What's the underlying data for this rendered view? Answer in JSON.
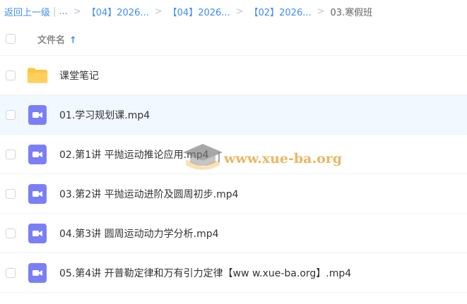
{
  "breadcrumb": {
    "back": "返回上一级",
    "pipe": "|",
    "ellipsis": "...",
    "sep": ">",
    "crumbs": [
      "【04】2026...",
      "【04】2026...",
      "【02】2026..."
    ],
    "current": "03.寒假班"
  },
  "header": {
    "column_title": "文件名",
    "sort_arrow": "↑"
  },
  "files": [
    {
      "name": "课堂笔记",
      "type": "folder"
    },
    {
      "name": "01.学习规划课.mp4",
      "type": "video"
    },
    {
      "name": "02.第1讲 平抛运动推论应用.mp4",
      "type": "video"
    },
    {
      "name": "03.第2讲 平抛运动进阶及圆周初步.mp4",
      "type": "video"
    },
    {
      "name": "04.第3讲 圆周运动动力学分析.mp4",
      "type": "video"
    },
    {
      "name": "05.第4讲 开普勒定律和万有引力定律【ww w.xue-ba.org】.mp4",
      "type": "video"
    }
  ],
  "watermark": {
    "text": "www.xue-ba.org",
    "icon": "graduation-cap-icon"
  },
  "colors": {
    "link": "#3b8cff",
    "folder": "#ffc53d",
    "video": "#7b7ff5",
    "highlight_row": "#f2f8ff",
    "watermark": "#e6aa46"
  }
}
